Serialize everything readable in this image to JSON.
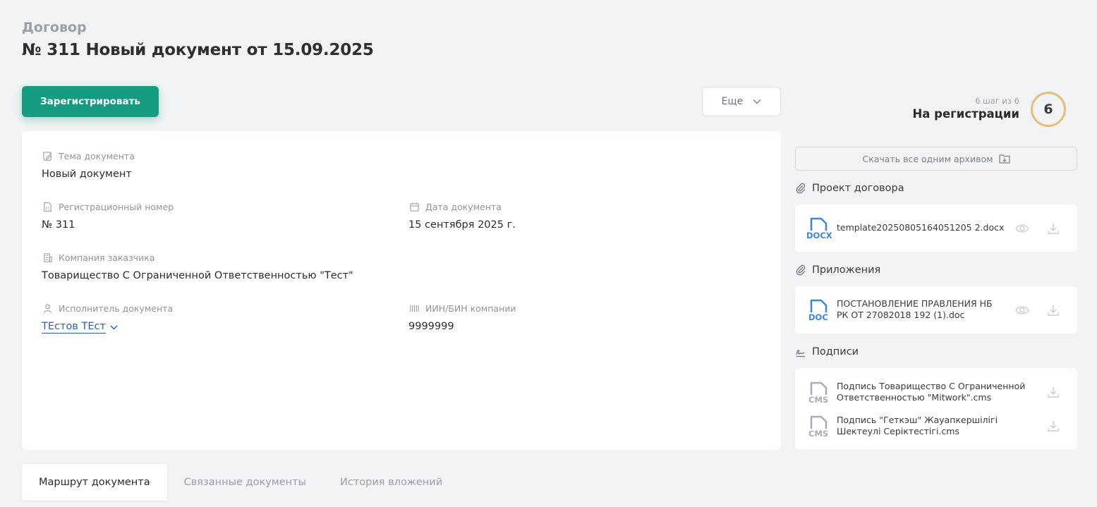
{
  "header": {
    "doc_type": "Договор",
    "title": "№ 311 Новый документ от 15.09.2025"
  },
  "toolbar": {
    "register_label": "Зарегистрировать",
    "more_label": "Еще"
  },
  "fields": {
    "subject": {
      "label": "Тема документа",
      "value": "Новый документ"
    },
    "reg_number": {
      "label": "Регистрационный номер",
      "value": "№ 311"
    },
    "doc_date": {
      "label": "Дата документа",
      "value": "15 сентября 2025 г."
    },
    "company": {
      "label": "Компания заказчика",
      "value": "Товарищество С Ограниченной Ответственностью \"Тест\""
    },
    "executor": {
      "label": "Исполнитель документа",
      "value": "ТЕстов ТЕст"
    },
    "iin": {
      "label": "ИИН/БИН компании",
      "value": "9999999"
    }
  },
  "status": {
    "step_text": "6 шаг из 6",
    "stage": "На регистрации",
    "step_number": "6"
  },
  "sidebar": {
    "download_all_label": "Скачать все одним архивом",
    "contract_section": "Проект договора",
    "contract_file": {
      "ext": "DOCX",
      "name": "template20250805164051205 2.docx"
    },
    "attachments_section": "Приложения",
    "attachment_file": {
      "ext": "DOC",
      "name": "ПОСТАНОВЛЕНИЕ ПРАВЛЕНИЯ НБ РК ОТ 27082018 192 (1).doc"
    },
    "signatures_section": "Подписи",
    "signatures": [
      {
        "ext": "CMS",
        "name": "Подпись Товарищество С Ограниченной Ответственностью \"Mitwork\".cms"
      },
      {
        "ext": "CMS",
        "name": "Подпись \"Геткэш\" Жауапкершілігі Шектеулі Серіктестігі.cms"
      }
    ]
  },
  "tabs": [
    {
      "label": "Маршрут документа"
    },
    {
      "label": "Связанные документы"
    },
    {
      "label": "История вложений"
    }
  ],
  "colors": {
    "accent": "#159b80",
    "link": "#2b5fb5",
    "file_blue": "#3d86e0",
    "file_grey": "#a8adb4",
    "step_ring": "#e3c07a"
  }
}
